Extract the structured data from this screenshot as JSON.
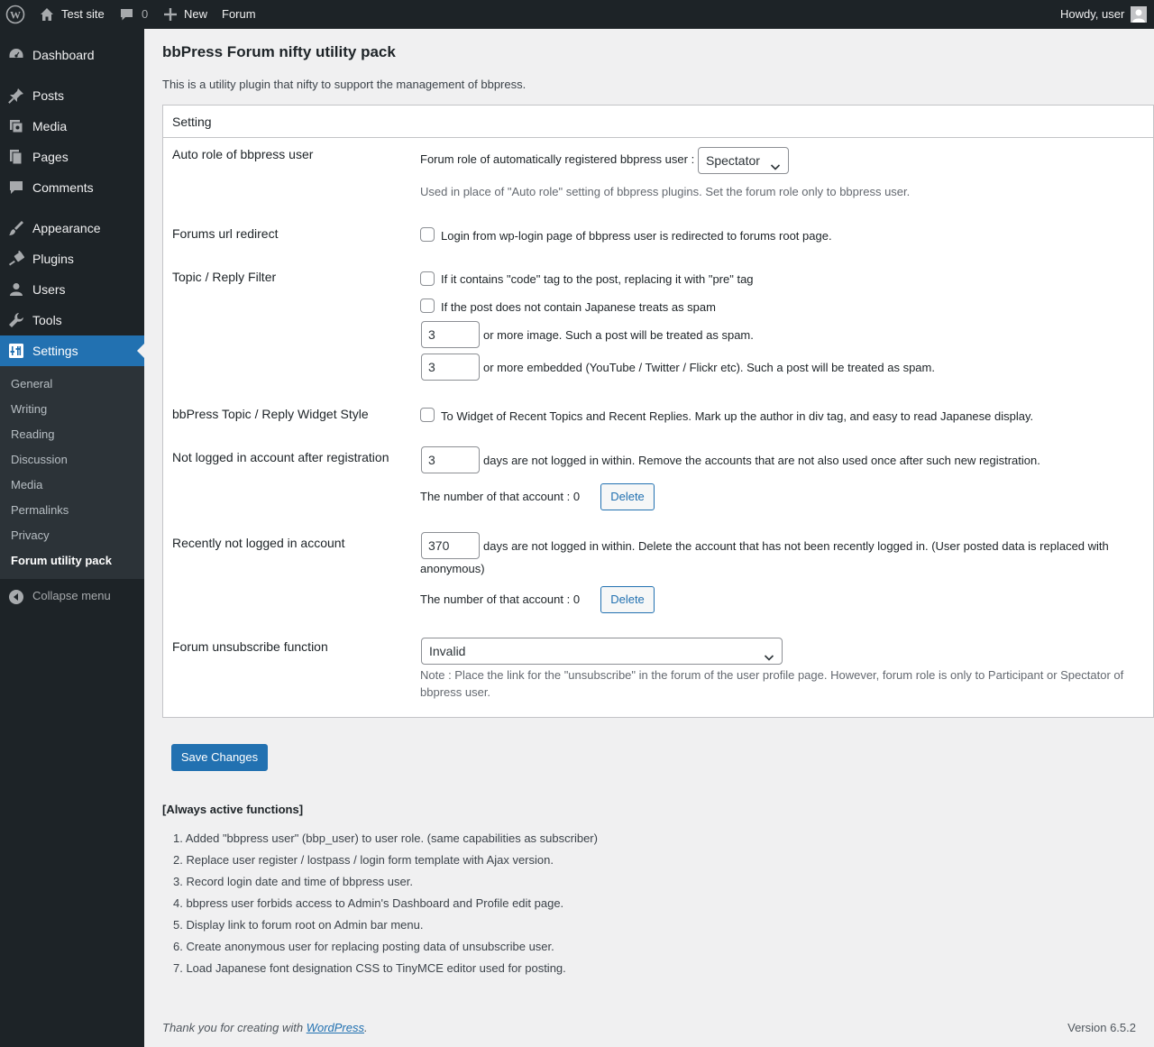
{
  "adminbar": {
    "site_name": "Test site",
    "comments_count": "0",
    "new_label": "New",
    "forum_label": "Forum",
    "howdy": "Howdy, user"
  },
  "sidebar": {
    "items": [
      {
        "label": "Dashboard",
        "icon": "dashboard-icon"
      },
      {
        "label": "Posts",
        "icon": "pin-icon"
      },
      {
        "label": "Media",
        "icon": "media-icon"
      },
      {
        "label": "Pages",
        "icon": "pages-icon"
      },
      {
        "label": "Comments",
        "icon": "comment-icon"
      },
      {
        "label": "Appearance",
        "icon": "brush-icon"
      },
      {
        "label": "Plugins",
        "icon": "plug-icon"
      },
      {
        "label": "Users",
        "icon": "user-icon"
      },
      {
        "label": "Tools",
        "icon": "wrench-icon"
      },
      {
        "label": "Settings",
        "icon": "settings-icon"
      }
    ],
    "submenu": [
      "General",
      "Writing",
      "Reading",
      "Discussion",
      "Media",
      "Permalinks",
      "Privacy",
      "Forum utility pack"
    ],
    "collapse_label": "Collapse menu"
  },
  "page": {
    "title": "bbPress Forum nifty utility pack",
    "intro": "This is a utility plugin that nifty to support the management of bbpress.",
    "panel_title": "Setting"
  },
  "settings": {
    "auto_role": {
      "label": "Auto role of bbpress user",
      "field_label": "Forum role of automatically registered bbpress user :",
      "selected": "Spectator",
      "description": "Used in place of \"Auto role\" setting of bbpress plugins. Set the forum role only to bbpress user."
    },
    "url_redirect": {
      "label": "Forums url redirect",
      "checkbox_label": "Login from wp-login page of bbpress user is redirected to forums root page."
    },
    "filter": {
      "label": "Topic / Reply Filter",
      "code_tag_label": "If it contains \"code\" tag to the post, replacing it with \"pre\" tag",
      "japanese_label": "If the post does not contain Japanese treats as spam",
      "image_count": "3",
      "image_label": "or more image. Such a post will be treated as spam.",
      "embed_count": "3",
      "embed_label": "or more embedded (YouTube / Twitter / Flickr etc). Such a post will be treated as spam."
    },
    "widget_style": {
      "label": "bbPress Topic / Reply Widget Style",
      "checkbox_label": "To Widget of Recent Topics and Recent Replies. Mark up the author in div tag, and easy to read Japanese display."
    },
    "not_logged_after_reg": {
      "label": "Not logged in account after registration",
      "days": "3",
      "days_label": "days are not logged in within. Remove the accounts that are not also used once after such new registration.",
      "count_label": "The number of that account : 0",
      "delete_label": "Delete"
    },
    "recently_not_logged": {
      "label": "Recently not logged in account",
      "days": "370",
      "days_label": "days are not logged in within. Delete the account that has not been recently logged in. (User posted data is replaced with",
      "days_label_cont": "anonymous)",
      "count_label": "The number of that account : 0",
      "delete_label": "Delete"
    },
    "unsubscribe": {
      "label": "Forum unsubscribe function",
      "selected": "Invalid",
      "note_line1": "Note : Place the link for the \"unsubscribe\" in the forum of the user profile page. However, forum role is only to Participant or Spectator of",
      "note_line2": "bbpress user."
    }
  },
  "save_label": "Save Changes",
  "always_active": {
    "title": "[Always active functions]",
    "items": [
      "1. Added \"bbpress user\" (bbp_user) to user role. (same capabilities as subscriber)",
      "2. Replace user register / lostpass / login form template with Ajax version.",
      "3. Record login date and time of bbpress user.",
      "4. bbpress user forbids access to Admin's Dashboard and Profile edit page.",
      "5. Display link to forum root on Admin bar menu.",
      "6. Create anonymous user for replacing posting data of unsubscribe user.",
      "7. Load Japanese font designation CSS to TinyMCE editor used for posting."
    ]
  },
  "footer": {
    "thanks_prefix": "Thank you for creating with",
    "wordpress_link": "WordPress",
    "thanks_suffix": ".",
    "version": "Version 6.5.2"
  },
  "colors": {
    "adminbar_bg": "#1d2327",
    "accent": "#2271b1",
    "page_bg": "#f0f0f1"
  }
}
